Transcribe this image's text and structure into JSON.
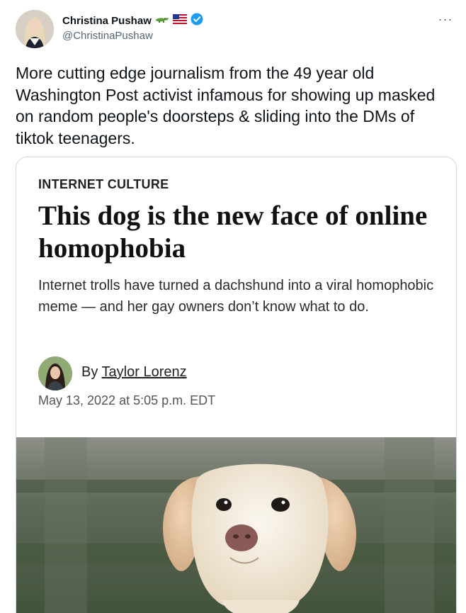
{
  "tweet": {
    "author": {
      "display_name": "Christina Pushaw",
      "handle": "@ChristinaPushaw",
      "badges": [
        "alligator-emoji",
        "us-flag-emoji",
        "verified-icon"
      ]
    },
    "more_label": "···",
    "text": "More cutting edge journalism from the 49 year old Washington Post activist infamous for showing up masked on random people's doorsteps & sliding into the DMs of tiktok teenagers."
  },
  "card": {
    "kicker": "INTERNET CULTURE",
    "headline": "This dog is the new face of online homophobia",
    "dek": "Internet trolls have turned a dachshund into a viral homophobic meme — and her gay owners don’t know what to do.",
    "byline_prefix": "By ",
    "author": "Taylor Lorenz",
    "date": "May 13, 2022 at 5:05 p.m. EDT",
    "image": "white-dachshund-photo"
  },
  "colors": {
    "text": "#0f1419",
    "secondary": "#536471",
    "verified": "#1d9bf0",
    "border": "#cfd9de"
  }
}
